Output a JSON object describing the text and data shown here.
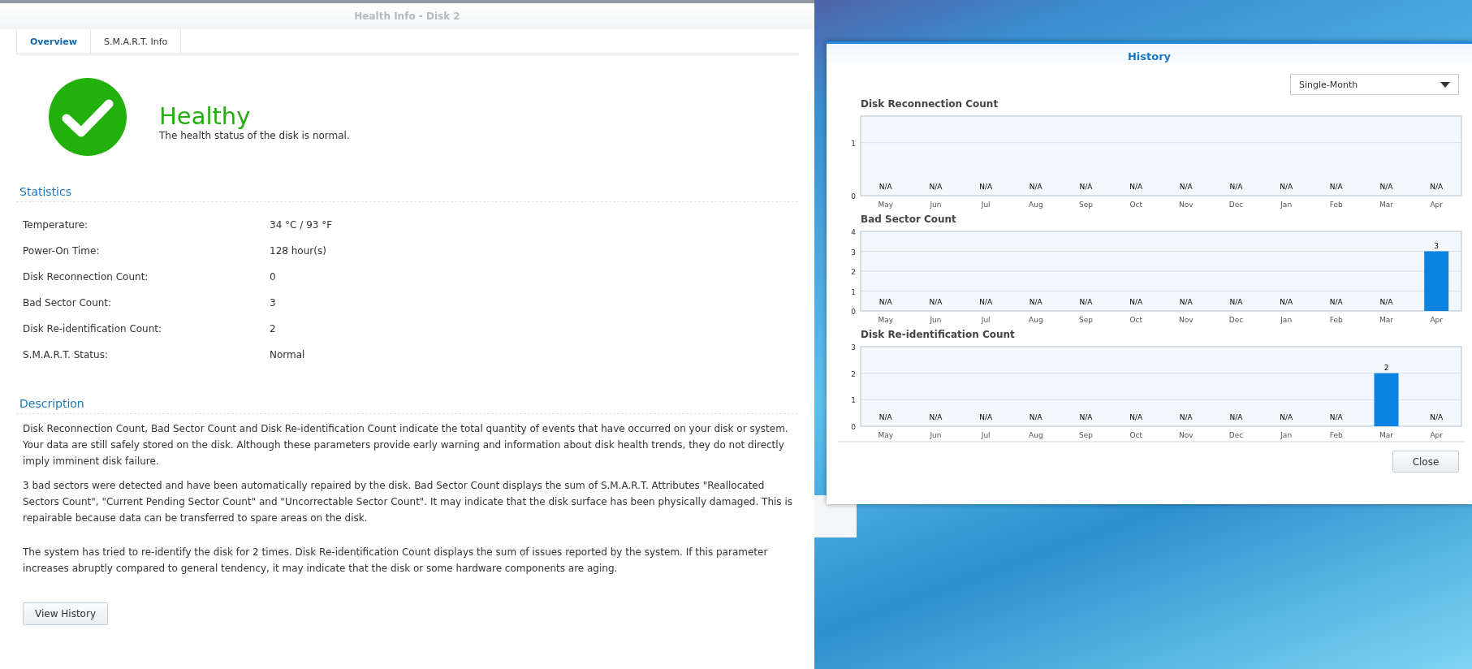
{
  "left_window": {
    "title": "Health Info - Disk 2",
    "tabs": [
      {
        "label": "Overview",
        "selected": true
      },
      {
        "label": "S.M.A.R.T. Info",
        "selected": false
      }
    ],
    "status": {
      "kind": "healthy",
      "heading": "Healthy",
      "message": "The health status of the disk is normal."
    },
    "statistics": {
      "heading": "Statistics",
      "rows": [
        {
          "label": "Temperature:",
          "value": "34 °C / 93 °F"
        },
        {
          "label": "Power-On Time:",
          "value": "128 hour(s)"
        },
        {
          "label": "Disk Reconnection Count:",
          "value": "0"
        },
        {
          "label": "Bad Sector Count:",
          "value": "3"
        },
        {
          "label": "Disk Re-identification Count:",
          "value": "2"
        },
        {
          "label": "S.M.A.R.T. Status:",
          "value": "Normal"
        }
      ]
    },
    "description": {
      "heading": "Description",
      "paragraphs": [
        "Disk Reconnection Count, Bad Sector Count and Disk Re-identification Count indicate the total quantity of events that have occurred on your disk or system. Your data are still safely stored on the disk. Although these parameters provide early warning and information about disk health trends, they do not directly imply imminent disk failure.",
        "3 bad sectors were detected and have been automatically repaired by the disk. Bad Sector Count displays the sum of S.M.A.R.T. Attributes \"Reallocated Sectors Count\", \"Current Pending Sector Count\" and \"Uncorrectable Sector Count\". It may indicate that the disk surface has been physically damaged. This is repairable because data can be transferred to spare areas on the disk.",
        "The system has tried to re-identify the disk for 2 times. Disk Re-identification Count displays the sum of issues reported by the system. If this parameter increases abruptly compared to general tendency, it may indicate that the disk or some hardware components are aging."
      ]
    },
    "button": "View History"
  },
  "history_window": {
    "title": "History",
    "period_select": {
      "value": "Single-Month"
    },
    "charts": [
      {
        "chart_data": {
          "type": "bar",
          "title": "Disk Reconnection Count",
          "categories": [
            "May",
            "Jun",
            "Jul",
            "Aug",
            "Sep",
            "Oct",
            "Nov",
            "Dec",
            "Jan",
            "Feb",
            "Mar",
            "Apr"
          ],
          "values": [
            null,
            null,
            null,
            null,
            null,
            null,
            null,
            null,
            null,
            null,
            null,
            null
          ],
          "value_labels": [
            "N/A",
            "N/A",
            "N/A",
            "N/A",
            "N/A",
            "N/A",
            "N/A",
            "N/A",
            "N/A",
            "N/A",
            "N/A",
            "N/A"
          ],
          "ylim": [
            0,
            1.5
          ],
          "yticks": [
            0,
            1
          ],
          "grid": true
        }
      },
      {
        "chart_data": {
          "type": "bar",
          "title": "Bad Sector Count",
          "categories": [
            "May",
            "Jun",
            "Jul",
            "Aug",
            "Sep",
            "Oct",
            "Nov",
            "Dec",
            "Jan",
            "Feb",
            "Mar",
            "Apr"
          ],
          "values": [
            null,
            null,
            null,
            null,
            null,
            null,
            null,
            null,
            null,
            null,
            null,
            3
          ],
          "value_labels": [
            "N/A",
            "N/A",
            "N/A",
            "N/A",
            "N/A",
            "N/A",
            "N/A",
            "N/A",
            "N/A",
            "N/A",
            "N/A",
            "3"
          ],
          "ylim": [
            0,
            4
          ],
          "yticks": [
            0,
            1,
            2,
            3,
            4
          ],
          "grid": true
        }
      },
      {
        "chart_data": {
          "type": "bar",
          "title": "Disk Re-identification Count",
          "categories": [
            "May",
            "Jun",
            "Jul",
            "Aug",
            "Sep",
            "Oct",
            "Nov",
            "Dec",
            "Jan",
            "Feb",
            "Mar",
            "Apr"
          ],
          "values": [
            null,
            null,
            null,
            null,
            null,
            null,
            null,
            null,
            null,
            null,
            2,
            null
          ],
          "value_labels": [
            "N/A",
            "N/A",
            "N/A",
            "N/A",
            "N/A",
            "N/A",
            "N/A",
            "N/A",
            "N/A",
            "N/A",
            "2",
            "N/A"
          ],
          "ylim": [
            0,
            3
          ],
          "yticks": [
            0,
            1,
            2,
            3
          ],
          "grid": true
        }
      }
    ],
    "close_button": "Close"
  }
}
